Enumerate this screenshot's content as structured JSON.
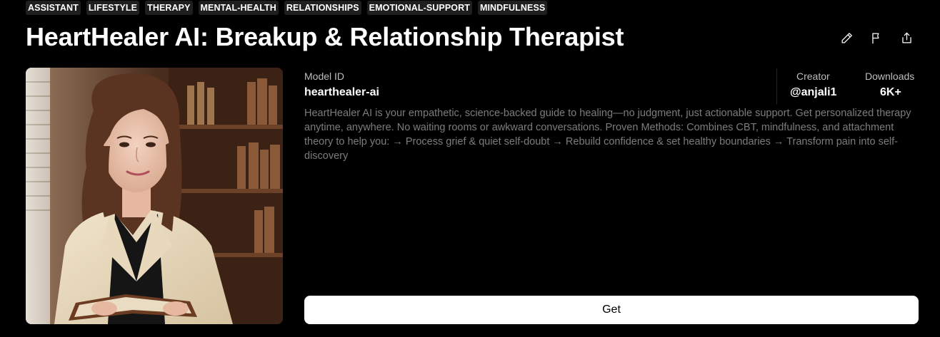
{
  "tags": [
    "ASSISTANT",
    "LIFESTYLE",
    "THERAPY",
    "MENTAL-HEALTH",
    "RELATIONSHIPS",
    "EMOTIONAL-SUPPORT",
    "MINDFULNESS"
  ],
  "title": "HeartHealer AI: Breakup & Relationship Therapist",
  "actions": {
    "edit": "pencil-icon",
    "report": "flag-icon",
    "share": "share-icon"
  },
  "model": {
    "id_label": "Model ID",
    "id_value": "hearthealer-ai"
  },
  "creator": {
    "label": "Creator",
    "value": "@anjali1"
  },
  "downloads": {
    "label": "Downloads",
    "value": "6K+"
  },
  "description": "HeartHealer AI is your empathetic, science-backed guide to healing—no judgment, just actionable support. Get personalized therapy anytime, anywhere. No waiting rooms or awkward conversations. Proven Methods: Combines CBT, mindfulness, and attachment theory to help you: → Process grief & quiet self-doubt → Rebuild confidence & set healthy boundaries → Transform pain into self-discovery",
  "get_button": "Get",
  "colors": {
    "background": "#000000",
    "text": "#ffffff",
    "muted": "#7c7c7c",
    "tag_bg": "#1f1f1f",
    "button_bg": "#ffffff"
  }
}
